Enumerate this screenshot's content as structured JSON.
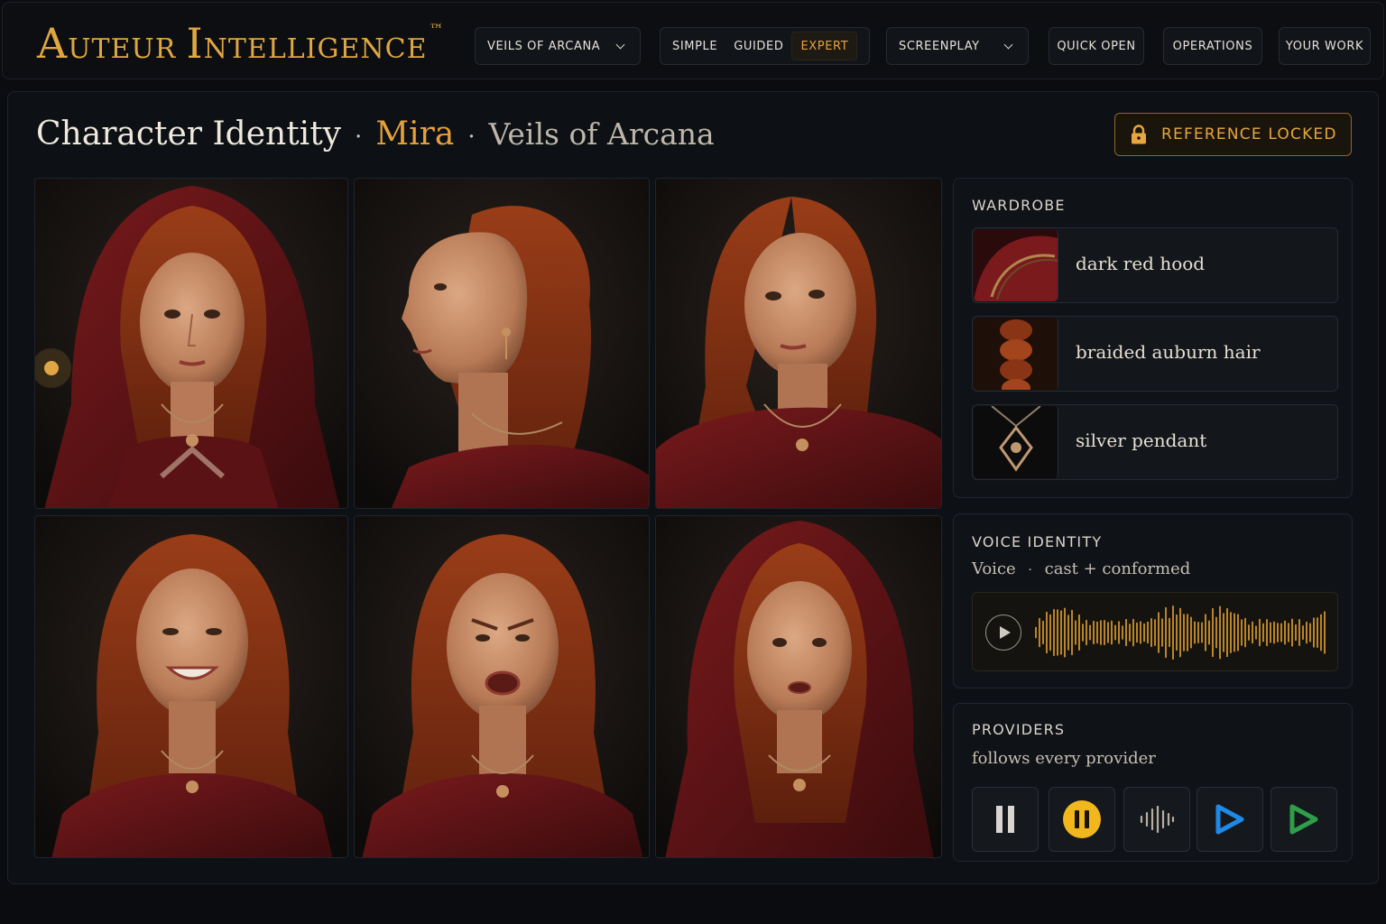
{
  "brand": {
    "first_initial": "A",
    "first_rest": "uteur",
    "second_initial": "I",
    "second_rest": "ntelligence",
    "tm": "™"
  },
  "topbar": {
    "project_label": "VEILS OF ARCANA",
    "modes": [
      "SIMPLE",
      "GUIDED",
      "EXPERT"
    ],
    "active_mode": "EXPERT",
    "view_label": "SCREENPLAY",
    "quick_open": "QUICK OPEN",
    "operations": "OPERATIONS",
    "your_work": "YOUR WORK"
  },
  "header": {
    "section": "Character Identity",
    "character": "Mira",
    "project": "Veils of Arcana",
    "separator": "·",
    "lock_label": "REFERENCE LOCKED"
  },
  "wardrobe": {
    "heading": "WARDROBE",
    "items": [
      {
        "label": "dark red hood",
        "thumb": "hood-thumbnail"
      },
      {
        "label": "braided auburn hair",
        "thumb": "braid-thumbnail"
      },
      {
        "label": "silver pendant",
        "thumb": "pendant-thumbnail"
      }
    ]
  },
  "voice": {
    "heading": "VOICE IDENTITY",
    "sub_left": "Voice",
    "sub_sep": "·",
    "sub_right": "cast + conformed",
    "waveform_color": "#e3a232"
  },
  "providers": {
    "heading": "PROVIDERS",
    "subtitle": "follows every provider",
    "icons": [
      "pause-bars-icon",
      "pause-circle-icon",
      "waveform-icon",
      "play-outline-blue-icon",
      "play-outline-green-icon"
    ]
  },
  "portraits": [
    "portrait-front-hood",
    "portrait-profile-left",
    "portrait-three-quarter",
    "portrait-smiling",
    "portrait-angry",
    "portrait-worried-hood"
  ],
  "colors": {
    "accent": "#e4a03c",
    "background": "#0a0c0f",
    "hood_red": "#6a1618",
    "hair": "#8a3416"
  }
}
